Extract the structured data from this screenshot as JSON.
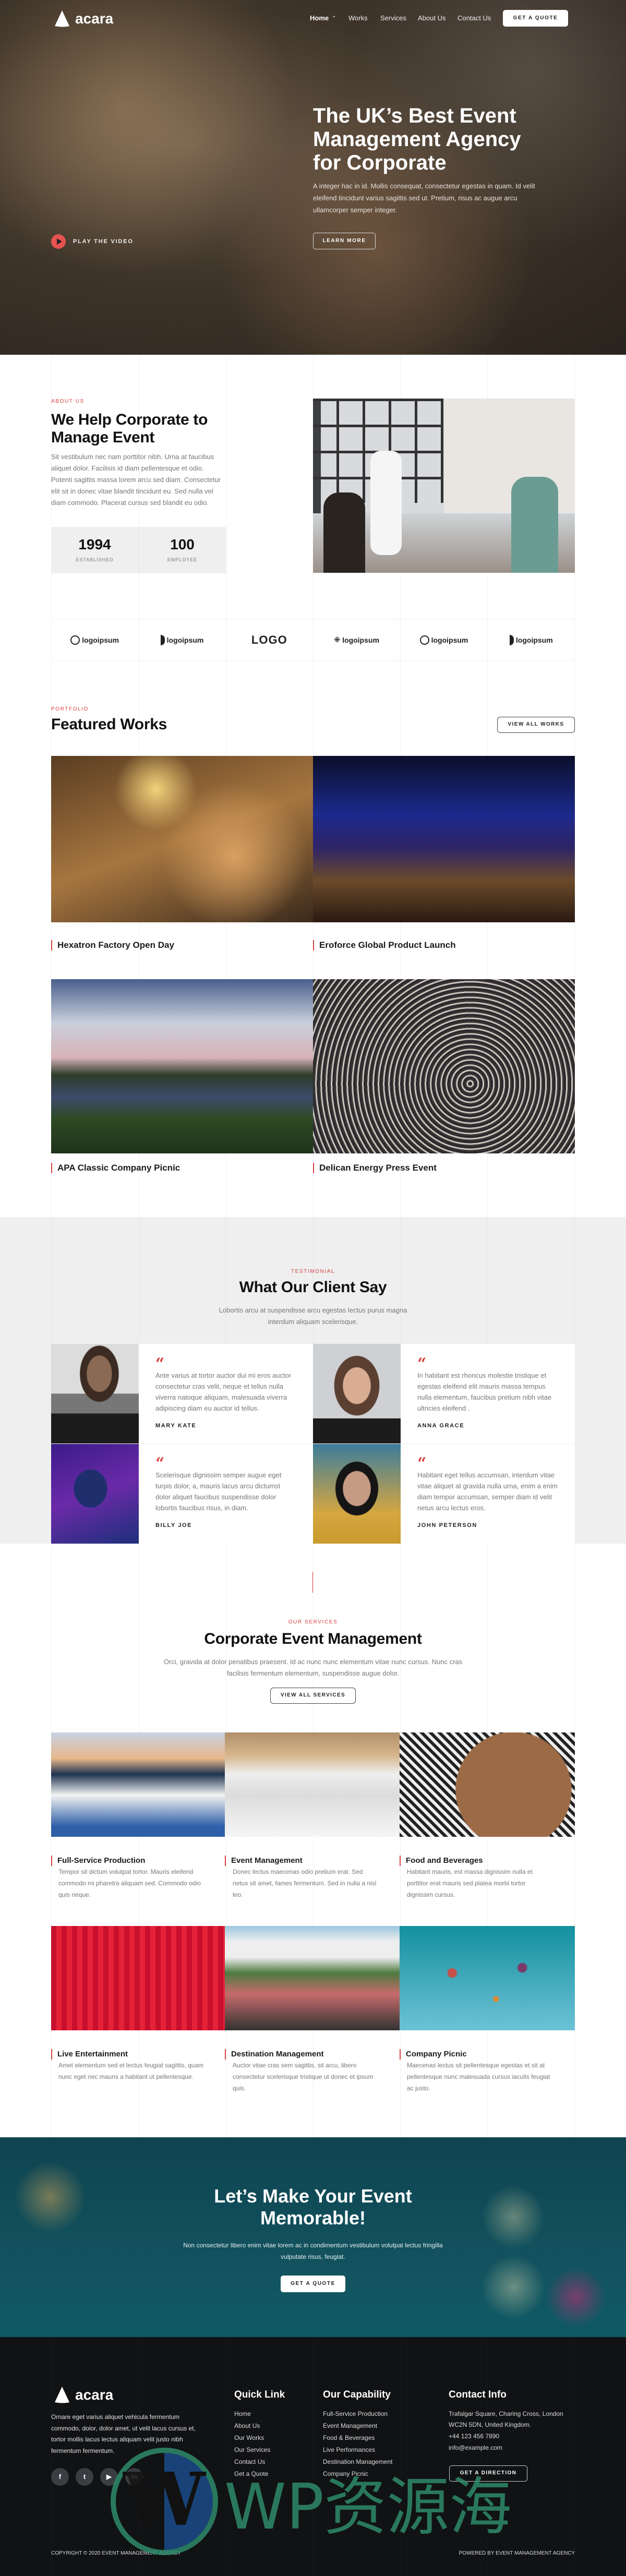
{
  "brand": {
    "name": "acara"
  },
  "nav": {
    "items": [
      "Home",
      "Works",
      "Services",
      "About Us",
      "Contact Us"
    ],
    "cta": "GET A QUOTE"
  },
  "hero": {
    "title": "The UK’s Best Event Management Agency for Corporate",
    "text": "A integer hac in id. Mollis consequat, consectetur egestas in quam. Id velit eleifend tincidunt varius sagittis sed ut. Pretium, risus ac augue arcu ullamcorper semper integer.",
    "button": "LEARN MORE",
    "play": "PLAY THE VIDEO"
  },
  "about": {
    "eyebrow": "ABOUT US",
    "title": "We Help Corporate to Manage Event",
    "text": "Sit vestibulum nec nam porttitor nibh. Urna at faucibus aliquet dolor. Facilisis id diam pellentesque et odio. Potenti sagittis massa lorem arcu sed diam. Consectetur elit sit in donec vitae blandit tincidunt eu. Sed nulla vel diam commodo. Placerat cursus sed blandit eu odio.",
    "stats": [
      {
        "value": "1994",
        "label": "ESTABLISHED"
      },
      {
        "value": "100",
        "label": "EMPLOYEE"
      }
    ]
  },
  "logos": [
    "logoipsum",
    "logoipsum",
    "LOGO",
    "logoipsum",
    "logoipsum",
    "logoipsum"
  ],
  "portfolio": {
    "eyebrow": "PORTFOLIO",
    "title": "Featured Works",
    "button": "VIEW ALL WORKS",
    "items": [
      "Hexatron Factory Open Day",
      "Eroforce Global Product Launch",
      "APA Classic Company Picnic",
      "Delican Energy Press Event"
    ]
  },
  "testimonial": {
    "eyebrow": "TESTIMONIAL",
    "title": "What Our Client Say",
    "text": "Lobortis arcu at suspendisse arcu egestas lectus purus magna interdum aliquam scelerisque.",
    "items": [
      {
        "quote": "Ante varius at tortor auctor dui mi eros auctor consectetur cras velit, neque et tellus nulla viverra natoque aliquam, malesuada viverra adipiscing diam eu auctor id tellus.",
        "name": "MARY KATE"
      },
      {
        "quote": "In habitant est rhoncus molestie tristique et egestas eleifend elit mauris massa tempus nulla elementum, faucibus pretium nibh vitae ultricies eleifend .",
        "name": "ANNA GRACE"
      },
      {
        "quote": "Scelerisque dignissim semper augue eget turpis dolor, a, mauris lacus arcu dictumst dolor aliquet faucibus suspendisse dolor lobortis faucibus risus, in diam.",
        "name": "BILLY JOE"
      },
      {
        "quote": "Habitant eget tellus accumsan, interdum vitae vitae aliquet at gravida nulla urna, enim a enim diam tempor accumsan, semper diam id velit netus arcu lectus eros.",
        "name": "JOHN PETERSON"
      }
    ]
  },
  "services": {
    "eyebrow": "OUR SERVICES",
    "title": "Corporate Event Management",
    "text": "Orci, gravida at dolor penatibus praesent. Id ac nunc nunc elementum vitae nunc cursus. Nunc cras facilisis fermentum elementum, suspendisse augue dolor.",
    "button": "VIEW ALL SERVICES",
    "items": [
      {
        "title": "Full-Service Production",
        "text": "Tempor sit dictum volutpat tortor. Mauris eleifend commodo mi pharetra aliquam sed. Commodo odio quis neque."
      },
      {
        "title": "Event Management",
        "text": "Donec lectus maecenas odio pretium erat. Sed netus sit amet, fames fermentum. Sed in nulla a nisl leo."
      },
      {
        "title": "Food and Beverages",
        "text": "Habitant mauris, est massa dignissim nulla et porttitor erat mauris sed platea morbi tortor dignissim cursus."
      },
      {
        "title": "Live Entertainment",
        "text": "Amet elementum sed et lectus feugiat sagittis, quam nunc eget nec mauris a habitant ut pellentesque."
      },
      {
        "title": "Destination Management",
        "text": "Auctor vitae cras sem sagittis, sit arcu, libero consectetur scelerisque tristique ut donec et ipsum quis."
      },
      {
        "title": "Company Picnic",
        "text": "Maecenas lectus sit pellentesque egestas et sit at pellentesque nunc malesuada cursus iaculis feugiat ac justo."
      }
    ]
  },
  "cta": {
    "title": "Let’s Make Your Event Memorable!",
    "text": "Non consectetur libero enim vitae lorem ac in condimentum vestibulum volutpat lectus fringilla vulputate risus, feugiat.",
    "button": "GET A QUOTE"
  },
  "footer": {
    "about": "Ornare eget varius aliquet vehicula fermentum commodo, dolor, dolor amet, ut velit lacus cursus et, tortor mollis lacus lectus aliquam velit justo nibh fermentum fermentum.",
    "social": [
      "facebook-icon",
      "twitter-icon",
      "youtube-icon",
      "linkedin-icon"
    ],
    "quick": {
      "title": "Quick Link",
      "items": [
        "Home",
        "About Us",
        "Our Works",
        "Our Services",
        "Contact Us",
        "Get a Quote"
      ]
    },
    "capability": {
      "title": "Our Capability",
      "items": [
        "Full-Service Production",
        "Event Management",
        "Food & Beverages",
        "Live Performances",
        "Destination Management",
        "Company Picnic"
      ]
    },
    "contact": {
      "title": "Contact Info",
      "address1": "Trafalgar Square, Charing Cross, London",
      "address2": "WC2N 5DN, United Kingdom.",
      "phone": "+44 123 456 7890",
      "email": "info@example.com",
      "button": "GET A DIRECTION"
    },
    "copyright": "COPYRIGHT © 2020 EVENT MANAGEMENT AGENCY",
    "powered": "POWERED BY EVENT MANAGEMENT AGENCY"
  },
  "watermark": "WP资源海",
  "colors": {
    "accent": "#d9413f",
    "dark": "#111214",
    "teal": "#124e57",
    "light_bg": "#efefef"
  }
}
